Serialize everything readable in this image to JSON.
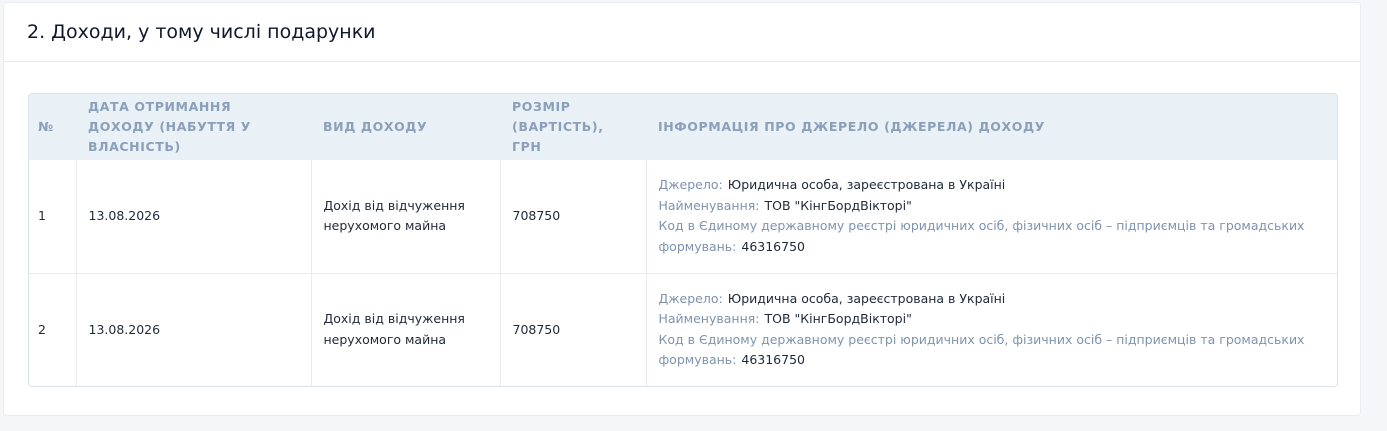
{
  "section": {
    "title": "2. Доходи, у тому числі подарунки"
  },
  "table": {
    "headers": {
      "number": "№",
      "date": "ДАТА ОТРИМАННЯ ДОХОДУ (НАБУТТЯ У ВЛАСНІСТЬ)",
      "type": "ВИД ДОХОДУ",
      "amount": "РОЗМІР (ВАРТІСТЬ), ГРН",
      "source": "ІНФОРМАЦІЯ ПРО ДЖЕРЕЛО (ДЖЕРЕЛА) ДОХОДУ"
    },
    "rows": [
      {
        "number": "1",
        "date": "13.08.2026",
        "type": "Дохід від відчуження нерухомого майна",
        "amount": "708750",
        "source_label": "Джерело:",
        "source_value": "Юридична особа, зареєстрована в Україні",
        "name_label": "Найменування:",
        "name_value": "ТОВ \"КінгБордВікторі\"",
        "code_label": "Код в Єдиному державному реєстрі юридичних осіб, фізичних осіб – підприємців та громадських формувань:",
        "code_value": "46316750"
      },
      {
        "number": "2",
        "date": "13.08.2026",
        "type": "Дохід від відчуження нерухомого майна",
        "amount": "708750",
        "source_label": "Джерело:",
        "source_value": "Юридична особа, зареєстрована в Україні",
        "name_label": "Найменування:",
        "name_value": "ТОВ \"КінгБордВікторі\"",
        "code_label": "Код в Єдиному державному реєстрі юридичних осіб, фізичних осіб – підприємців та громадських формувань:",
        "code_value": "46316750"
      }
    ]
  }
}
